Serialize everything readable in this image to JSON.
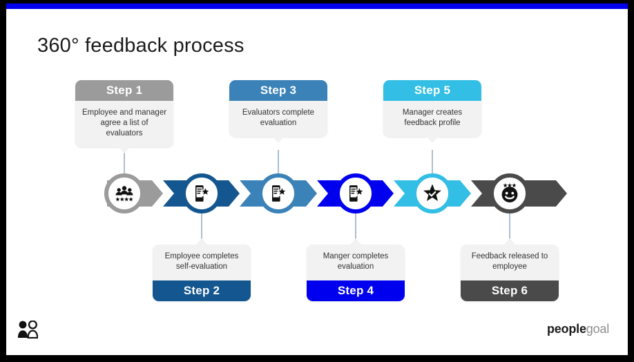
{
  "slide": {
    "title": "360° feedback process",
    "accent_bar_color": "#0000EE",
    "frame_color": "#000000",
    "background": "#FFFFFF"
  },
  "steps": [
    {
      "label": "Step 1",
      "description": "Employee and manager agree a list of evaluators",
      "color": "#9B9B9B",
      "position": "top",
      "icon": "people-group-stars-icon"
    },
    {
      "label": "Step 2",
      "description": "Employee completes self-evaluation",
      "color": "#14568F",
      "position": "bottom",
      "icon": "mobile-review-star-icon"
    },
    {
      "label": "Step 3",
      "description": "Evaluators complete evaluation",
      "color": "#3B82B8",
      "position": "top",
      "icon": "mobile-review-star-icon"
    },
    {
      "label": "Step 4",
      "description": "Manger completes evaluation",
      "color": "#0000EE",
      "position": "bottom",
      "icon": "mobile-review-star-icon"
    },
    {
      "label": "Step 5",
      "description": "Manager creates feedback profile",
      "color": "#33BEE5",
      "position": "top",
      "icon": "star-check-icon"
    },
    {
      "label": "Step 6",
      "description": "Feedback released to employee",
      "color": "#4A4A4A",
      "position": "bottom",
      "icon": "smiley-rating-stars-icon"
    }
  ],
  "footer": {
    "mark_icon": "two-people-icon",
    "brand_bold": "people",
    "brand_light": "goal"
  }
}
